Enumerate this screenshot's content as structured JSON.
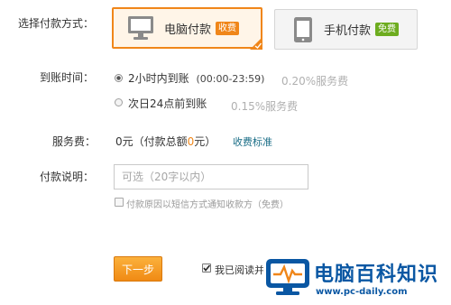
{
  "payment_method": {
    "label": "选择付款方式：",
    "options": [
      {
        "label": "电脑付款",
        "tag": "收费",
        "tag_color": "#f08619",
        "selected": true,
        "icon": "monitor-icon"
      },
      {
        "label": "手机付款",
        "tag": "免费",
        "tag_color": "#6dac1f",
        "selected": false,
        "icon": "tablet-icon"
      }
    ]
  },
  "arrival_time": {
    "label": "到账时间：",
    "options": [
      {
        "label": "2小时内到账",
        "time_range": "(00:00-23:59)",
        "fee": "0.20%服务费",
        "selected": true
      },
      {
        "label": "次日24点前到账",
        "fee": "0.15%服务费",
        "selected": false
      }
    ]
  },
  "service_fee": {
    "label": "服务费：",
    "value_prefix": "0元（付款总额",
    "value_highlight": "0",
    "value_suffix": "元）",
    "link": "收费标准",
    "highlight_color": "#f08619"
  },
  "payment_note": {
    "label": "付款说明：",
    "placeholder": "可选（20字以内）",
    "sms_notify_label": "付款原因以短信方式通知收款方（免费）"
  },
  "footer": {
    "next_button": "下一步",
    "agree_label": "我已阅读并"
  },
  "watermark": {
    "name": "电脑百科知识",
    "url": "www.pc-daily.com",
    "color": "#0a57a3"
  },
  "colors": {
    "accent": "#f08619",
    "free": "#6dac1f",
    "link": "#1b6e87"
  }
}
